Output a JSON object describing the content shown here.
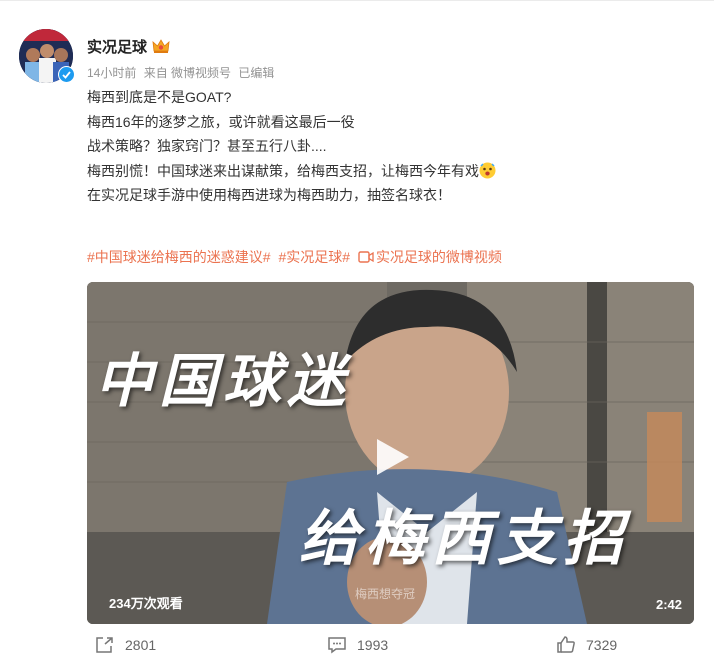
{
  "post": {
    "username": "实况足球",
    "time": "14小时前",
    "source": "来自 微博视频号",
    "edited": "已编辑",
    "lines": [
      "梅西到底是不是GOAT?",
      "梅西16年的逐梦之旅，或许就看这最后一役",
      "战术策略？独家窍门？甚至五行八卦....",
      "梅西别慌！中国球迷来出谋献策，给梅西支招，让梅西今年有戏",
      "在实况足球手游中使用梅西进球为梅西助力，抽签名球衣！"
    ],
    "hashtags": [
      "#中国球迷给梅西的迷惑建议#",
      "#实况足球#",
      "实况足球的微博视频"
    ]
  },
  "video": {
    "overlay_line1": "中国球迷",
    "overlay_line2": "给梅西支招",
    "views": "234万次观看",
    "duration": "2:42",
    "watermark": "梅西想夺冠"
  },
  "actions": {
    "repost_count": "2801",
    "comment_count": "1993",
    "like_count": "7329"
  },
  "colors": {
    "accent": "#eb7350",
    "verified": "#1d9bf0"
  },
  "icons": [
    "verified-icon",
    "crown-icon",
    "emoji-icon",
    "video-icon",
    "play-icon",
    "repost-icon",
    "comment-icon",
    "like-icon"
  ]
}
